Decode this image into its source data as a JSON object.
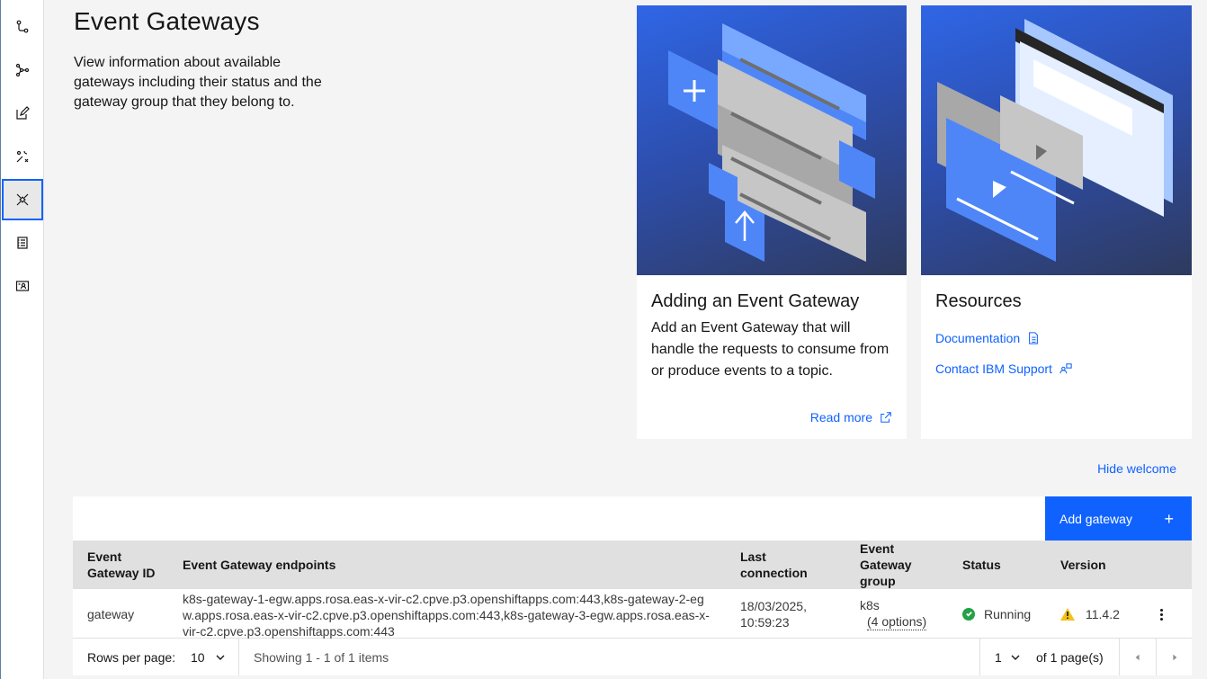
{
  "page": {
    "title": "Event Gateways",
    "description": "View information about available gateways including their status and the gateway group that they belong to."
  },
  "rail": {
    "items": [
      {
        "icon": "topology-icon"
      },
      {
        "icon": "network-icon"
      },
      {
        "icon": "edit-icon"
      },
      {
        "icon": "tools-icon"
      },
      {
        "icon": "gateway-icon",
        "active": true
      },
      {
        "icon": "catalog-icon"
      },
      {
        "icon": "user-profile-icon"
      }
    ]
  },
  "tiles": {
    "gateway": {
      "title": "Adding an Event Gateway",
      "body": "Add an Event Gateway that will handle the requests to consume from or produce events to a topic.",
      "link": "Read more"
    },
    "resources": {
      "title": "Resources",
      "documentation": "Documentation",
      "support": "Contact IBM Support"
    }
  },
  "hide_welcome": "Hide welcome",
  "toolbar": {
    "add_label": "Add gateway",
    "add_icon": "+"
  },
  "table": {
    "headers": {
      "id": "Event Gateway ID",
      "endpoints": "Event Gateway endpoints",
      "last": "Last connection",
      "group": "Event Gateway group",
      "status": "Status",
      "version": "Version"
    },
    "rows": [
      {
        "id": "gateway",
        "endpoints": "k8s-gateway-1-egw.apps.rosa.eas-x-vir-c2.cpve.p3.openshiftapps.com:443,k8s-gateway-2-egw.apps.rosa.eas-x-vir-c2.cpve.p3.openshiftapps.com:443,k8s-gateway-3-egw.apps.rosa.eas-x-vir-c2.cpve.p3.openshiftapps.com:443",
        "last": "18/03/2025, 10:59:23",
        "group": "k8s",
        "group_options": "(4 options)",
        "status": "Running",
        "version": "11.4.2"
      }
    ]
  },
  "pager": {
    "rows_label": "Rows per page:",
    "rows_value": "10",
    "showing": "Showing 1 - 1 of 1 items",
    "page_value": "1",
    "of_pages": "of 1 page(s)"
  },
  "colors": {
    "accent": "#0f62fe",
    "success": "#24a148",
    "warning": "#f1c21b"
  }
}
